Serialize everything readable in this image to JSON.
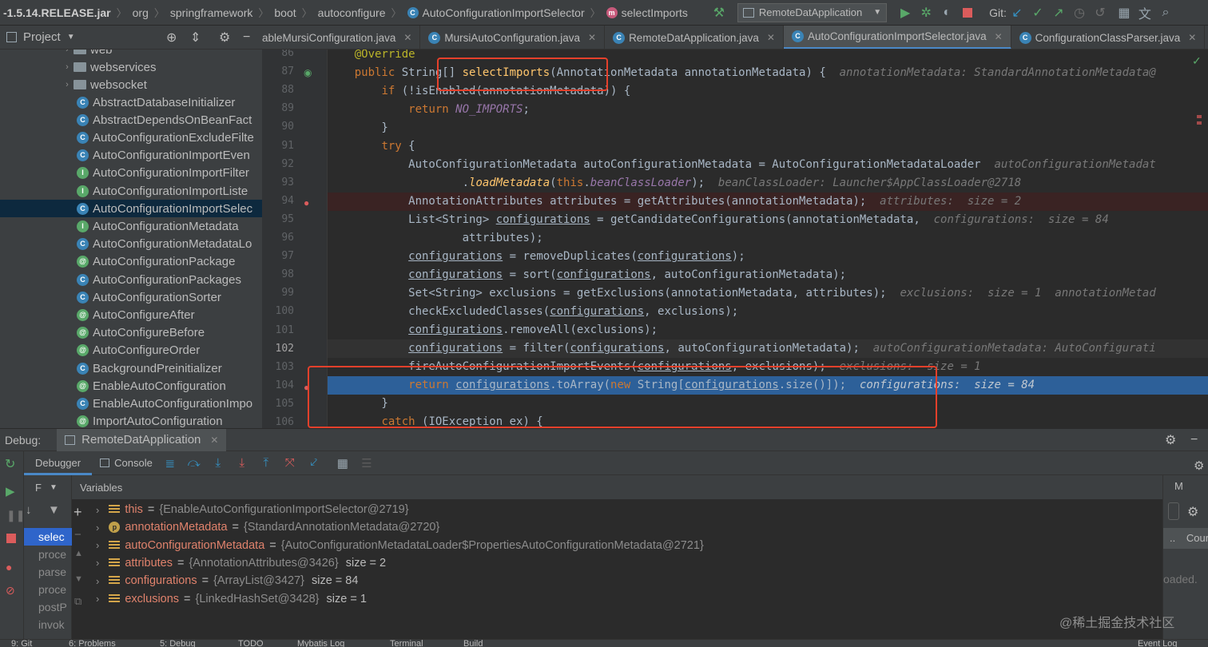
{
  "breadcrumb": {
    "jar": "-1.5.14.RELEASE.jar",
    "items": [
      "org",
      "springframework",
      "boot",
      "autoconfigure"
    ],
    "class_name": "AutoConfigurationImportSelector",
    "method": "selectImports"
  },
  "toolbar": {
    "run_config": "RemoteDatApplication",
    "git_label": "Git:"
  },
  "project": {
    "title": "Project",
    "folders": [
      "web",
      "webservices",
      "websocket"
    ],
    "items": [
      {
        "name": "AbstractDatabaseInitializer",
        "kind": "c"
      },
      {
        "name": "AbstractDependsOnBeanFact",
        "kind": "c"
      },
      {
        "name": "AutoConfigurationExcludeFilte",
        "kind": "c"
      },
      {
        "name": "AutoConfigurationImportEven",
        "kind": "c"
      },
      {
        "name": "AutoConfigurationImportFilter",
        "kind": "i"
      },
      {
        "name": "AutoConfigurationImportListe",
        "kind": "i"
      },
      {
        "name": "AutoConfigurationImportSelec",
        "kind": "c"
      },
      {
        "name": "AutoConfigurationMetadata",
        "kind": "i"
      },
      {
        "name": "AutoConfigurationMetadataLo",
        "kind": "c"
      },
      {
        "name": "AutoConfigurationPackage",
        "kind": "a"
      },
      {
        "name": "AutoConfigurationPackages",
        "kind": "c"
      },
      {
        "name": "AutoConfigurationSorter",
        "kind": "c"
      },
      {
        "name": "AutoConfigureAfter",
        "kind": "a"
      },
      {
        "name": "AutoConfigureBefore",
        "kind": "a"
      },
      {
        "name": "AutoConfigureOrder",
        "kind": "a"
      },
      {
        "name": "BackgroundPreinitializer",
        "kind": "c"
      },
      {
        "name": "EnableAutoConfiguration",
        "kind": "a"
      },
      {
        "name": "EnableAutoConfigurationImpo",
        "kind": "c"
      },
      {
        "name": "ImportAutoConfiguration",
        "kind": "a"
      }
    ],
    "selected_index": 6
  },
  "tabs": [
    {
      "label": "ableMursiConfiguration.java",
      "active": false
    },
    {
      "label": "MursiAutoConfiguration.java",
      "active": false
    },
    {
      "label": "RemoteDatApplication.java",
      "active": false
    },
    {
      "label": "AutoConfigurationImportSelector.java",
      "active": true
    },
    {
      "label": "ConfigurationClassParser.java",
      "active": false
    }
  ],
  "code": {
    "line_numbers": [
      "86",
      "87",
      "88",
      "89",
      "90",
      "91",
      "92",
      "93",
      "94",
      "95",
      "96",
      "97",
      "98",
      "99",
      "100",
      "101",
      "102",
      "103",
      "104",
      "105",
      "106"
    ],
    "hints": {
      "l87": "annotationMetadata: StandardAnnotationMetadata@",
      "l92": "autoConfigurationMetadat",
      "l93": "beanClassLoader: Launcher$AppClassLoader@2718",
      "l94": "attributes:  size = 2",
      "l95": "configurations:  size = 84",
      "l99a": "exclusions:  size = 1",
      "l99b": "annotationMetad",
      "l102": "autoConfigurationMetadata: AutoConfigurati",
      "l103": "exclusions:  size = 1",
      "l104": "configurations:  size = 84"
    }
  },
  "debug": {
    "label": "Debug:",
    "session": "RemoteDatApplication",
    "tab_debugger": "Debugger",
    "tab_console": "Console",
    "frames_label": "F",
    "variables_label": "Variables",
    "frames": [
      "selec",
      "proce",
      "parse",
      "proce",
      "postP",
      "invok"
    ],
    "variables": [
      {
        "name": "this",
        "value": "{EnableAutoConfigurationImportSelector@2719}",
        "extra": "",
        "icon": "field"
      },
      {
        "name": "annotationMetadata",
        "value": "{StandardAnnotationMetadata@2720}",
        "extra": "",
        "icon": "param"
      },
      {
        "name": "autoConfigurationMetadata",
        "value": "{AutoConfigurationMetadataLoader$PropertiesAutoConfigurationMetadata@2721}",
        "extra": "",
        "icon": "field"
      },
      {
        "name": "attributes",
        "value": "{AnnotationAttributes@3426}",
        "extra": "size = 2",
        "icon": "field"
      },
      {
        "name": "configurations",
        "value": "{ArrayList@3427}",
        "extra": "size = 84",
        "icon": "field"
      },
      {
        "name": "exclusions",
        "value": "{LinkedHashSet@3428}",
        "extra": "size = 1",
        "icon": "field"
      }
    ],
    "right_label_m": "M",
    "right_label_cour": "Cour",
    "right_label_loaded": "oaded."
  },
  "status": {
    "items": [
      "9: Git",
      "6: Problems",
      "5: Debug",
      "TODO",
      "Mybatis Log",
      "Terminal",
      "Build",
      "Event Log"
    ]
  },
  "watermark": "@稀土掘金技术社区"
}
